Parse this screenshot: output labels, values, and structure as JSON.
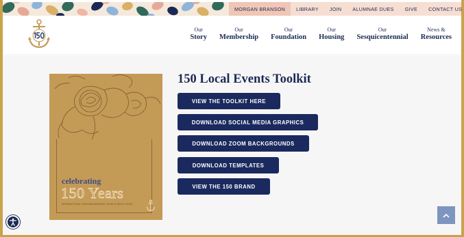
{
  "utility_nav": {
    "items": [
      "MORGAN BRANSON",
      "LIBRARY",
      "JOIN",
      "ALUMNAE DUES",
      "GIVE",
      "CONTACT US"
    ]
  },
  "search_icon": "search-icon",
  "logo": {
    "icon": "anchor-150-logo"
  },
  "main_nav": [
    {
      "top": "Our",
      "main": "Story"
    },
    {
      "top": "Our",
      "main": "Membership"
    },
    {
      "top": "Our",
      "main": "Foundation"
    },
    {
      "top": "Our",
      "main": "Housing"
    },
    {
      "top": "Our",
      "main": "Sesquicentennial"
    },
    {
      "top": "News &",
      "main": "Resources"
    }
  ],
  "page": {
    "title": "150 Local Events Toolkit",
    "buttons": [
      "VIEW THE TOOLKIT HERE",
      "DOWNLOAD SOCIAL MEDIA GRAPHICS",
      "DOWNLOAD ZOOM BACKGROUNDS",
      "DOWNLOAD TEMPLATES",
      "VIEW THE 150 BRAND"
    ]
  },
  "cover": {
    "line1": "celebrating",
    "line2": "150 Years",
    "tagline": "INTERNATIONAL 150th ANNIVERSARY LOCAL EVENTS GUIDE"
  },
  "colors": {
    "navy": "#1b2a5e",
    "gold": "#c49a57",
    "utility_bg": "#f6ded3",
    "to_top": "#7e95bf"
  }
}
